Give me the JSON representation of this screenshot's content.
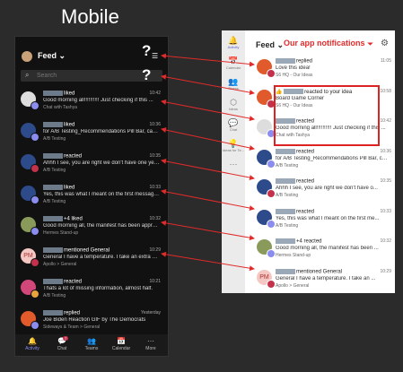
{
  "title": "Mobile",
  "mobile": {
    "feed_label": "Feed",
    "search_placeholder": "Search",
    "question_marks": [
      "?",
      "?"
    ],
    "items": [
      {
        "l1": "liked",
        "time": "10:42",
        "l2": "Good morning all!!!!!!!!!! Just checking if this ...",
        "l3": "Chat with Tashya",
        "av": "#ddd",
        "badge": "#8b8cf0"
      },
      {
        "l1": "liked",
        "time": "10:36",
        "l2": "for A/B Testing_Recommendations Pill Bar, can...",
        "l3": "A/B Testing",
        "av": "#2d4a8a",
        "badge": "#8b8cf0"
      },
      {
        "l1": "reacted",
        "time": "10:35",
        "l2": "Ahhh I see, you are right we don't have one yet...",
        "l3": "A/B Testing",
        "av": "#2d4a8a",
        "badge": "#c4314b"
      },
      {
        "l1": "liked",
        "time": "10:33",
        "l2": "Yes, this was what I meant on the first message...",
        "l3": "A/B Testing",
        "av": "#2d4a8a",
        "badge": "#8b8cf0"
      },
      {
        "l1": "+4 liked",
        "time": "10:32",
        "l2": "Good morning all, the manifest has been approv...",
        "l3": "Hermes Stand-up",
        "av": "#8a9a5b",
        "badge": "#8b8cf0"
      },
      {
        "l1": "mentioned General",
        "time": "10:29",
        "l2": "General I have a temperature. I take an extra sic...",
        "l3": "Apollo > General",
        "av": "#f4c7c3",
        "badge": "#c4314b",
        "initials": "PM"
      },
      {
        "l1": "reacted",
        "time": "10:21",
        "l2": "Thats a lot of missing information, almost half.",
        "l3": "A/B Testing",
        "av": "#d1477a",
        "badge": "#e8a33d"
      },
      {
        "l1": "replied",
        "time": "Yesterday",
        "l2": "Joe Biden Reaction GIF by The Democrats",
        "l3": "Sideways & Team > General",
        "av": "#e05a2b",
        "badge": "#8b8cf0"
      }
    ],
    "nav": [
      {
        "icon": "bell-icon",
        "glyph": "🔔",
        "label": "Activity",
        "active": true
      },
      {
        "icon": "chat-icon",
        "glyph": "💬",
        "label": "Chat",
        "count": "7"
      },
      {
        "icon": "teams-icon",
        "glyph": "👥",
        "label": "Teams"
      },
      {
        "icon": "calendar-icon",
        "glyph": "📅",
        "label": "Calendar"
      },
      {
        "icon": "more-icon",
        "glyph": "⋯",
        "label": "More"
      }
    ]
  },
  "desktop": {
    "feed_label": "Feed",
    "annotation": "Our app notifications",
    "rail": [
      {
        "icon": "bell-icon",
        "glyph": "🔔",
        "label": "Activity",
        "active": true
      },
      {
        "icon": "calendar-icon",
        "glyph": "📅",
        "label": "Calendar"
      },
      {
        "icon": "teams-icon",
        "glyph": "👥",
        "label": "Teams"
      },
      {
        "icon": "hexagon-icon",
        "glyph": "⬡",
        "label": "Ideas"
      },
      {
        "icon": "chat-icon",
        "glyph": "💬",
        "label": "Chat"
      },
      {
        "icon": "ideas-app-icon",
        "glyph": "💡",
        "label": "Ideas for Te..."
      },
      {
        "icon": "more-icon",
        "glyph": "⋯",
        "label": ""
      }
    ],
    "items": [
      {
        "l1": "replied",
        "time": "11:05",
        "l2": "Love this idea!",
        "l3": "S6 HQ - Our Ideas",
        "av": "#e05a2b",
        "badge": "#c4314b"
      },
      {
        "l1": "reacted to your idea",
        "time": "10:58",
        "l2": "Board Game Corner",
        "l3": "S6 HQ - Our Ideas",
        "av": "#e05a2b",
        "badge": "#c4314b",
        "emoji": "👍"
      },
      {
        "l1": "reacted",
        "time": "10:42",
        "l2": "Good morning all!!!!!!!!!! Just checking if this ...",
        "l3": "Chat with Tashya",
        "av": "#ddd",
        "badge": "#8b8cf0"
      },
      {
        "l1": "reacted",
        "time": "10:36",
        "l2": "for A/B Testing_Recommendations Pill Bar, can...",
        "l3": "A/B Testing",
        "av": "#2d4a8a",
        "badge": "#8b8cf0"
      },
      {
        "l1": "reacted",
        "time": "10:35",
        "l2": "Ahhh I see, you are right we don't have o...",
        "l3": "A/B Testing",
        "av": "#2d4a8a",
        "badge": "#c4314b"
      },
      {
        "l1": "reacted",
        "time": "10:33",
        "l2": "Yes, this was what I meant on the first me...",
        "l3": "A/B Testing",
        "av": "#2d4a8a",
        "badge": "#8b8cf0"
      },
      {
        "l1": "+4 reacted",
        "time": "10:32",
        "l2": "Good morning all, the manifest has been ...",
        "l3": "Hermes Stand-up",
        "av": "#8a9a5b",
        "badge": "#8b8cf0"
      },
      {
        "l1": "mentioned General",
        "time": "10:29",
        "l2": "General I have a temperature. I take an ...",
        "l3": "Apollo > General",
        "av": "#f4c7c3",
        "badge": "#c4314b",
        "initials": "PM"
      }
    ]
  },
  "colors": {
    "annotation_red": "#e02b2b",
    "accent": "#5b5fc7"
  }
}
